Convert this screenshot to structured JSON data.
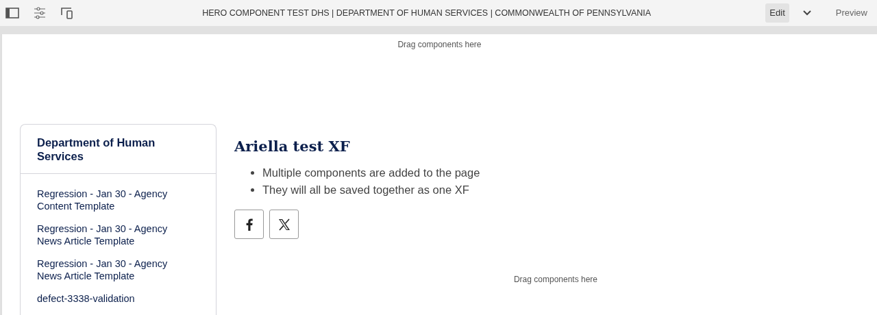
{
  "toolbar": {
    "title": "HERO COMPONENT TEST DHS | DEPARTMENT OF HUMAN SERVICES | COMMONWEALTH OF PENNSYLVANIA",
    "modes": [
      {
        "label": "Edit",
        "selected": true
      },
      {
        "label": "Preview",
        "selected": false
      }
    ]
  },
  "page": {
    "top_dropzone": "Drag components here",
    "sidebar": {
      "title": "Department of Human Services",
      "links": [
        "Regression - Jan 30 - Agency Content Template",
        "Regression - Jan 30 - Agency News Article Template",
        "Regression - Jan 30 - Agency News Article Template",
        "defect-3338-validation"
      ]
    },
    "main": {
      "heading": "Ariella test XF",
      "bullets": [
        "Multiple components are added to the page",
        "They will all be saved together as one XF"
      ],
      "share_buttons": [
        {
          "kind": "facebook"
        },
        {
          "kind": "x"
        }
      ],
      "bottom_dropzone": "Drag components here"
    }
  }
}
